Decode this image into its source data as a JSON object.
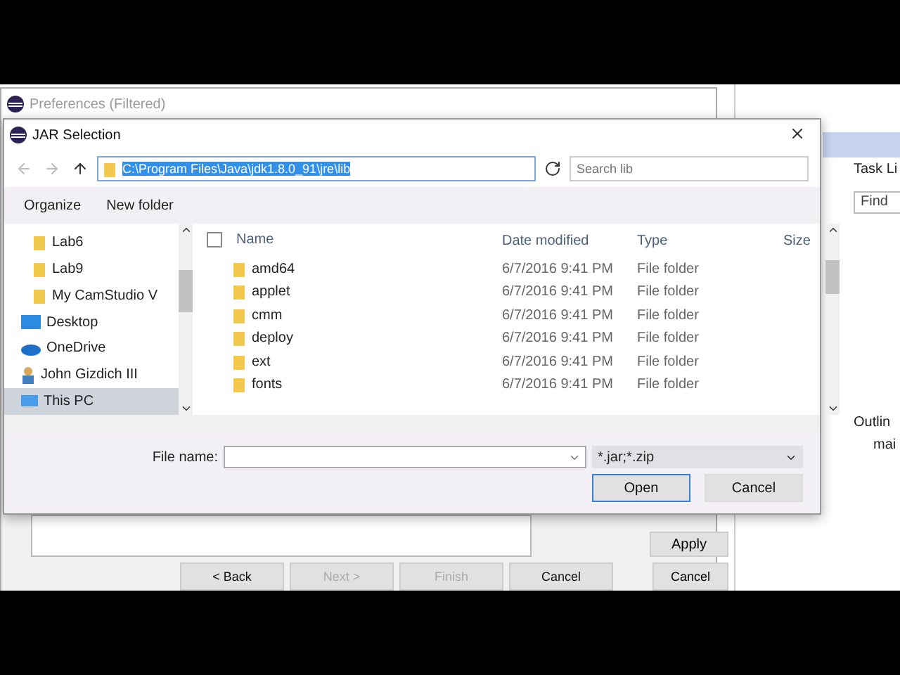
{
  "back_window": {
    "title": "Preferences (Filtered)",
    "apply": "Apply",
    "buttons": [
      {
        "label": "< Back",
        "disabled": false
      },
      {
        "label": "Next >",
        "disabled": true
      },
      {
        "label": "Finish",
        "disabled": true
      },
      {
        "label": "Cancel",
        "disabled": false
      }
    ],
    "cancel": "Cancel"
  },
  "ide": {
    "task_tab": "Task Li",
    "find": "Find",
    "outline_tab": "Outlin",
    "outline_item": "mai"
  },
  "dialog": {
    "title": "JAR Selection",
    "address": "C:\\Program Files\\Java\\jdk1.8.0_91\\jre\\lib",
    "search": {
      "placeholder": "Search lib"
    },
    "organize": "Organize",
    "new_folder": "New folder",
    "nav": [
      {
        "label": "Lab6",
        "kind": "folder",
        "selected": false
      },
      {
        "label": "Lab9",
        "kind": "folder",
        "selected": false
      },
      {
        "label": "My CamStudio V",
        "kind": "folder",
        "selected": false
      },
      {
        "label": "Desktop",
        "kind": "desktop",
        "selected": false
      },
      {
        "label": "OneDrive",
        "kind": "cloud",
        "selected": false
      },
      {
        "label": "John Gizdich III",
        "kind": "user",
        "selected": false
      },
      {
        "label": "This PC",
        "kind": "pc",
        "selected": true
      }
    ],
    "select_all": {
      "checked": false
    },
    "columns": [
      "Name",
      "Date modified",
      "Type",
      "Size"
    ],
    "rows": [
      {
        "name": "amd64",
        "date": "6/7/2016 9:41 PM",
        "type": "File folder"
      },
      {
        "name": "applet",
        "date": "6/7/2016 9:41 PM",
        "type": "File folder"
      },
      {
        "name": "cmm",
        "date": "6/7/2016 9:41 PM",
        "type": "File folder"
      },
      {
        "name": "deploy",
        "date": "6/7/2016 9:41 PM",
        "type": "File folder"
      },
      {
        "name": "ext",
        "date": "6/7/2016 9:41 PM",
        "type": "File folder"
      },
      {
        "name": "fonts",
        "date": "6/7/2016 9:41 PM",
        "type": "File folder"
      }
    ],
    "file_name_label": "File name:",
    "filter": "*.jar;*.zip",
    "open": "Open",
    "cancel": "Cancel"
  }
}
